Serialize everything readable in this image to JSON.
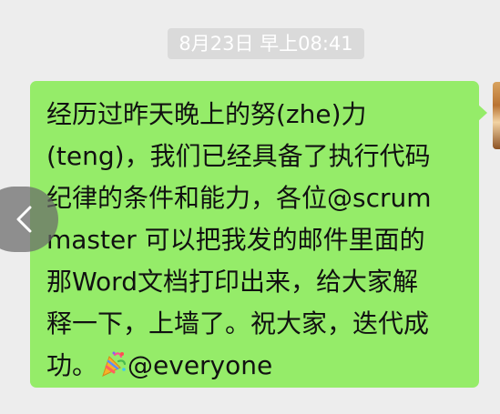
{
  "chat": {
    "timestamp": "8月23日 早上08:41",
    "message": {
      "lines": [
        "经历过昨天晚上的努(zhe)力",
        "(teng)，我们已经具备了执行代码",
        "纪律的条件和能力，各位@scrum",
        "master 可以把我发的邮件里面的",
        "那Word文档打印出来，给大家解",
        "释一下，上墙了。祝大家，迭代成",
        "功。"
      ],
      "tail_after_icon": "@everyone",
      "icon": "party-popper-icon",
      "bubble_color": "#95ec69"
    }
  },
  "navigation": {
    "back_icon": "chevron-left-icon"
  }
}
